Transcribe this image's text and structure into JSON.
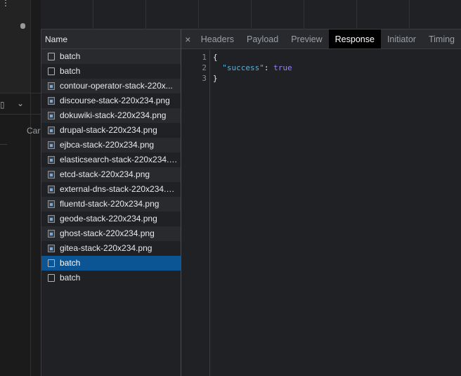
{
  "left_fragment": {
    "partial_label": "Car"
  },
  "name_column": {
    "header": "Name",
    "rows": [
      {
        "name": "batch",
        "type": "doc"
      },
      {
        "name": "batch",
        "type": "doc"
      },
      {
        "name": "contour-operator-stack-220x...",
        "type": "img"
      },
      {
        "name": "discourse-stack-220x234.png",
        "type": "img"
      },
      {
        "name": "dokuwiki-stack-220x234.png",
        "type": "img"
      },
      {
        "name": "drupal-stack-220x234.png",
        "type": "img"
      },
      {
        "name": "ejbca-stack-220x234.png",
        "type": "img"
      },
      {
        "name": "elasticsearch-stack-220x234.p...",
        "type": "img"
      },
      {
        "name": "etcd-stack-220x234.png",
        "type": "img"
      },
      {
        "name": "external-dns-stack-220x234.p...",
        "type": "img"
      },
      {
        "name": "fluentd-stack-220x234.png",
        "type": "img"
      },
      {
        "name": "geode-stack-220x234.png",
        "type": "img"
      },
      {
        "name": "ghost-stack-220x234.png",
        "type": "img"
      },
      {
        "name": "gitea-stack-220x234.png",
        "type": "img"
      },
      {
        "name": "batch",
        "type": "doc",
        "selected": true
      },
      {
        "name": "batch",
        "type": "doc"
      }
    ]
  },
  "detail": {
    "close_symbol": "×",
    "tabs": [
      "Headers",
      "Payload",
      "Preview",
      "Response",
      "Initiator",
      "Timing"
    ],
    "active_tab": "Response",
    "response_lines": [
      {
        "num": "1",
        "text": "{"
      },
      {
        "num": "2",
        "key": "\"success\"",
        "sep": ": ",
        "value": "true"
      },
      {
        "num": "3",
        "text": "}"
      }
    ]
  },
  "colors": {
    "selected_row": "#0b5594",
    "json_key": "#5db0d7",
    "json_value": "#9980ff"
  }
}
